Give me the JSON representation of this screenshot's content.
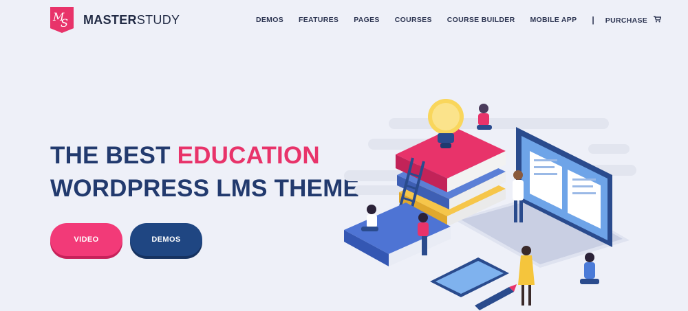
{
  "brand": {
    "badge_m": "M",
    "badge_s": "S",
    "name_bold": "MASTER",
    "name_light": "STUDY"
  },
  "nav": {
    "items": [
      "DEMOS",
      "FEATURES",
      "PAGES",
      "COURSES",
      "COURSE BUILDER",
      "MOBILE APP"
    ],
    "separator": "|",
    "purchase": "PURCHASE",
    "cart_icon": "shopping-cart-icon"
  },
  "hero": {
    "title_part1": "THE BEST ",
    "title_accent": "EDUCATION",
    "title_line2": "WORDPRESS LMS THEME",
    "video_label": "VIDEO",
    "demos_label": "DEMOS"
  },
  "colors": {
    "background": "#eef0f8",
    "accent_pink": "#e8336a",
    "navy": "#223a6e",
    "button_navy": "#1f4682"
  }
}
